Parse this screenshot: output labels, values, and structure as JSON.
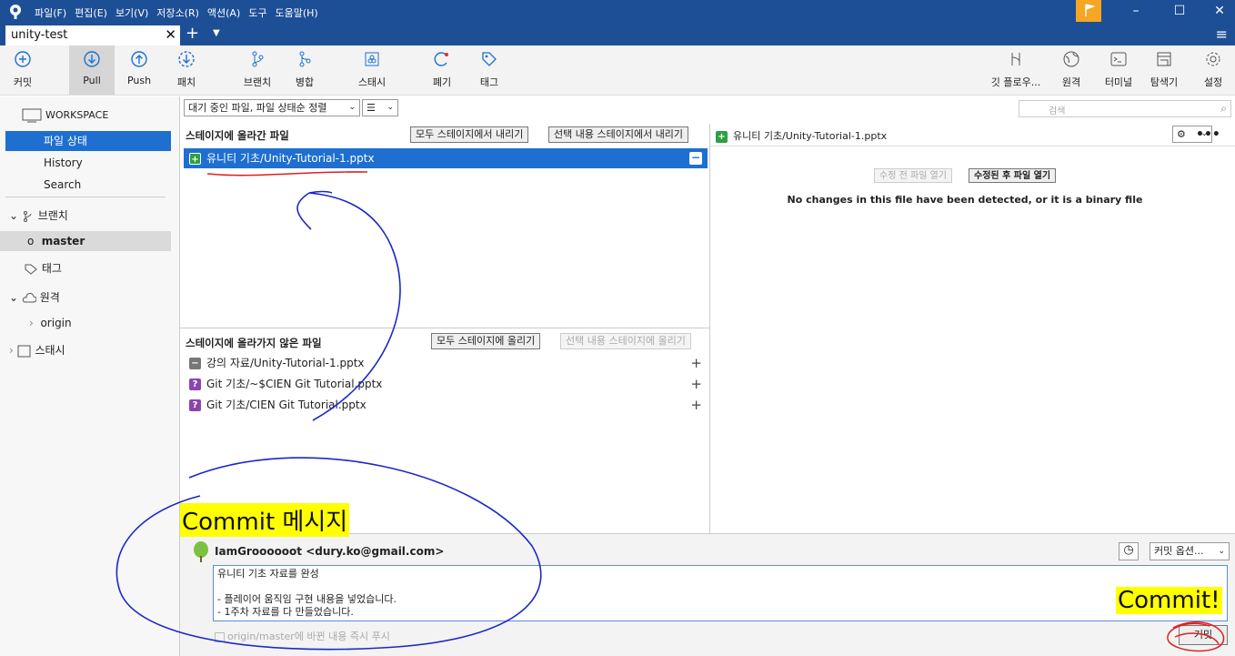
{
  "menu": [
    "파일(F)",
    "편집(E)",
    "보기(V)",
    "저장소(R)",
    "액션(A)",
    "도구",
    "도움말(H)"
  ],
  "tab": {
    "title": "unity-test"
  },
  "toolbar": {
    "commit": "커밋",
    "pull": "Pull",
    "push": "Push",
    "patch": "패치",
    "branch": "브랜치",
    "merge": "병합",
    "stash": "스태시",
    "discard": "폐기",
    "tag": "태그",
    "gitflow": "깃 플로우...",
    "remote": "원격",
    "terminal": "터미널",
    "explorer": "탐색기",
    "settings": "설정"
  },
  "sidebar": {
    "workspace": "WORKSPACE",
    "file_status": "파일 상태",
    "history": "History",
    "search": "Search",
    "branches": "브랜치",
    "master": "master",
    "tags": "태그",
    "remotes": "원격",
    "origin": "origin",
    "stashes": "스태시"
  },
  "filter": {
    "sort": "대기 중인 파일, 파일 상태순 정렬",
    "view": "☰"
  },
  "search": {
    "placeholder": "검색"
  },
  "staged": {
    "header": "스테이지에 올라간 파일",
    "unstage_all": "모두 스테이지에서 내리기",
    "unstage_selected": "선택 내용 스테이지에서 내리기",
    "files": [
      {
        "name": "유니티 기초/Unity-Tutorial-1.pptx"
      }
    ]
  },
  "unstaged": {
    "header": "스테이지에 올라가지 않은 파일",
    "stage_all": "모두 스테이지에 올리기",
    "stage_selected": "선택 내용 스테이지에 올리기",
    "files": [
      {
        "name": "강의 자료/Unity-Tutorial-1.pptx",
        "status": "removed"
      },
      {
        "name": "Git 기초/~$CIEN Git Tutorial.pptx",
        "status": "unknown"
      },
      {
        "name": "Git 기초/CIEN Git Tutorial.pptx",
        "status": "unknown"
      }
    ]
  },
  "diff": {
    "file": "유니티 기초/Unity-Tutorial-1.pptx",
    "open_before": "수정 전 파일 열기",
    "open_after": "수정된 후 파일 열기",
    "message": "No changes in this file have been detected, or it is a binary file"
  },
  "commit": {
    "author": "IamGroooooot <dury.ko@gmail.com>",
    "message_lines": [
      "유니티 기초 자료를 완성",
      "",
      "- 플레이어 움직임 구현 내용을 넣었습니다.",
      "- 1주차 자료를 다 만들었습니다."
    ],
    "push_option": "origin/master에 바뀐 내용 즉시 푸시",
    "options": "커밋 옵션...",
    "commit_button": "커밋"
  },
  "annotations": {
    "commit_msg": "Commit 메시지",
    "commit_excl": "Commit!"
  },
  "colors": {
    "titlebar": "#1d4f96",
    "selection": "#1e6fd0",
    "added": "#2ea043",
    "question": "#8e44ad",
    "highlight": "#ffff00"
  }
}
